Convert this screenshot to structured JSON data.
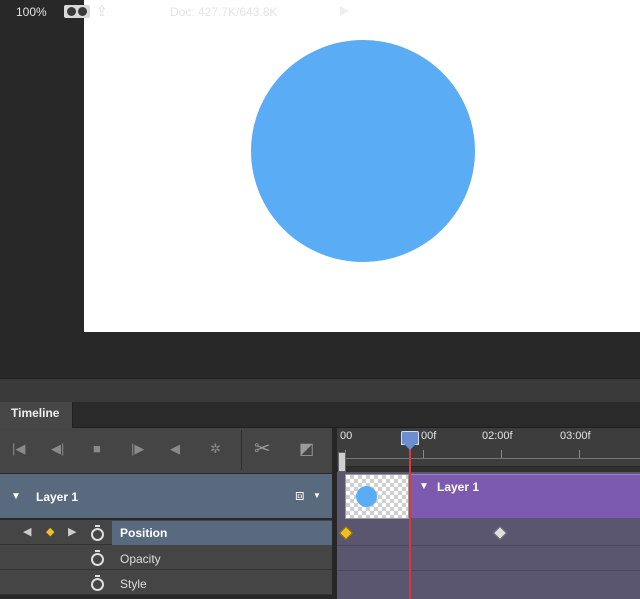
{
  "status_bar": {
    "zoom": "100%",
    "doc_size": "Doc: 427.7K/643.8K"
  },
  "timeline": {
    "tab_label": "Timeline",
    "ruler_ticks": [
      "00",
      "00f",
      "02:00f",
      "03:00f"
    ],
    "layer": {
      "name": "Layer 1",
      "bar_label": "Layer 1"
    },
    "properties": [
      {
        "label": "Position",
        "selected": true
      },
      {
        "label": "Opacity",
        "selected": false
      },
      {
        "label": "Style",
        "selected": false
      }
    ]
  },
  "colors": {
    "shape_fill": "#5aacf5",
    "layer_bar": "#7b5ab0",
    "playhead": "#d63a3a",
    "selected_row": "#5a6a7e"
  },
  "icons": {
    "controls": [
      "go-to-first-frame-icon",
      "previous-frame-icon",
      "stop-icon",
      "next-frame-icon",
      "audio-icon",
      "settings-icon",
      "split-at-playhead-icon",
      "transition-icon"
    ]
  }
}
